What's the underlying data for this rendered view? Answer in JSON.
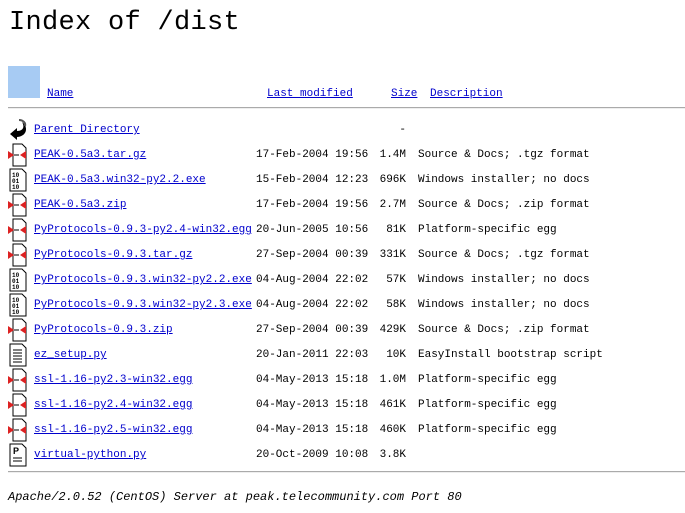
{
  "title": "Index of /dist",
  "columns": {
    "name": "Name",
    "modified": "Last modified",
    "size": "Size",
    "description": "Description"
  },
  "parent": {
    "label": "Parent Directory",
    "size": "-",
    "icon": "back-arrow-icon"
  },
  "rows": [
    {
      "name": "PEAK-0.5a3.tar.gz",
      "modified": "17-Feb-2004 19:56",
      "size": "1.4M",
      "description": "Source & Docs; .tgz format",
      "icon": "compressed-icon"
    },
    {
      "name": "PEAK-0.5a3.win32-py2.2.exe",
      "modified": "15-Feb-2004 12:23",
      "size": "696K",
      "description": "Windows installer; no docs",
      "icon": "binary-icon"
    },
    {
      "name": "PEAK-0.5a3.zip",
      "modified": "17-Feb-2004 19:56",
      "size": "2.7M",
      "description": "Source & Docs; .zip format",
      "icon": "compressed-icon"
    },
    {
      "name": "PyProtocols-0.9.3-py2.4-win32.egg",
      "modified": "20-Jun-2005 10:56",
      "size": "81K",
      "description": "Platform-specific egg",
      "icon": "compressed-icon"
    },
    {
      "name": "PyProtocols-0.9.3.tar.gz",
      "modified": "27-Sep-2004 00:39",
      "size": "331K",
      "description": "Source & Docs; .tgz format",
      "icon": "compressed-icon"
    },
    {
      "name": "PyProtocols-0.9.3.win32-py2.2.exe",
      "modified": "04-Aug-2004 22:02",
      "size": "57K",
      "description": "Windows installer; no docs",
      "icon": "binary-icon"
    },
    {
      "name": "PyProtocols-0.9.3.win32-py2.3.exe",
      "modified": "04-Aug-2004 22:02",
      "size": "58K",
      "description": "Windows installer; no docs",
      "icon": "binary-icon"
    },
    {
      "name": "PyProtocols-0.9.3.zip",
      "modified": "27-Sep-2004 00:39",
      "size": "429K",
      "description": "Source & Docs; .zip format",
      "icon": "compressed-icon"
    },
    {
      "name": "ez_setup.py",
      "modified": "20-Jan-2011 22:03",
      "size": "10K",
      "description": "EasyInstall bootstrap script",
      "icon": "text-icon"
    },
    {
      "name": "ssl-1.16-py2.3-win32.egg",
      "modified": "04-May-2013 15:18",
      "size": "1.0M",
      "description": "Platform-specific egg",
      "icon": "compressed-icon"
    },
    {
      "name": "ssl-1.16-py2.4-win32.egg",
      "modified": "04-May-2013 15:18",
      "size": "461K",
      "description": "Platform-specific egg",
      "icon": "compressed-icon"
    },
    {
      "name": "ssl-1.16-py2.5-win32.egg",
      "modified": "04-May-2013 15:18",
      "size": "460K",
      "description": "Platform-specific egg",
      "icon": "compressed-icon"
    },
    {
      "name": "virtual-python.py",
      "modified": "20-Oct-2009 10:08",
      "size": "3.8K",
      "description": "",
      "icon": "python-file-icon"
    }
  ],
  "footer": "Apache/2.0.52 (CentOS) Server at peak.telecommunity.com Port 80"
}
